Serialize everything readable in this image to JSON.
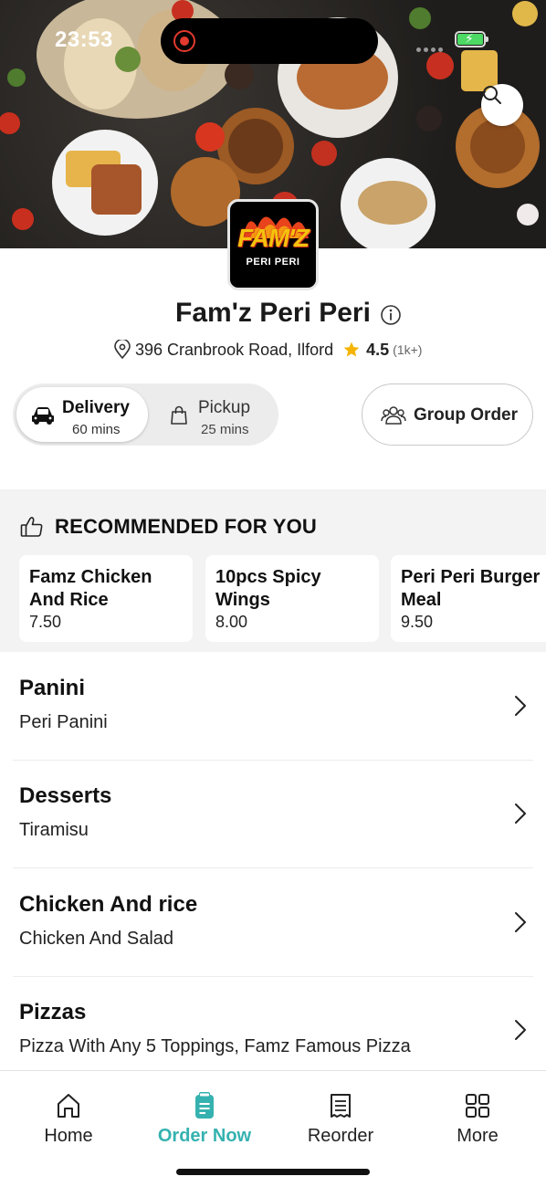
{
  "status_bar": {
    "time": "23:53"
  },
  "restaurant": {
    "logo": {
      "brand": "FAM'Z",
      "tagline": "PERI PERI"
    },
    "name": "Fam'z Peri Peri",
    "address": "396 Cranbrook Road, Ilford",
    "rating": "4.5",
    "rating_count": "(1k+)"
  },
  "order_modes": {
    "delivery": {
      "label": "Delivery",
      "time": "60 mins",
      "selected": true
    },
    "pickup": {
      "label": "Pickup",
      "time": "25 mins",
      "selected": false
    }
  },
  "group_order": {
    "label": "Group Order"
  },
  "recommended": {
    "heading": "RECOMMENDED FOR YOU",
    "items": [
      {
        "name": "Famz Chicken And Rice",
        "price": "7.50"
      },
      {
        "name": "10pcs Spicy Wings",
        "price": "8.00"
      },
      {
        "name": "Peri Peri Burger Meal",
        "price": "9.50"
      }
    ]
  },
  "menu": [
    {
      "title": "Panini",
      "subtitle": "Peri Panini"
    },
    {
      "title": "Desserts",
      "subtitle": "Tiramisu"
    },
    {
      "title": "Chicken And rice",
      "subtitle": "Chicken And Salad"
    },
    {
      "title": "Pizzas",
      "subtitle": "Pizza With Any 5 Toppings, Famz Famous Pizza"
    }
  ],
  "bottom_nav": [
    {
      "label": "Home",
      "icon": "home-icon",
      "active": false
    },
    {
      "label": "Order Now",
      "icon": "order-now-icon",
      "active": true
    },
    {
      "label": "Reorder",
      "icon": "receipt-icon",
      "active": false
    },
    {
      "label": "More",
      "icon": "grid-icon",
      "active": false
    }
  ],
  "colors": {
    "accent": "#35b2b0",
    "star": "#f5b400",
    "recommended_bg": "#f3f3f3",
    "toggle_bg": "#ececec"
  }
}
